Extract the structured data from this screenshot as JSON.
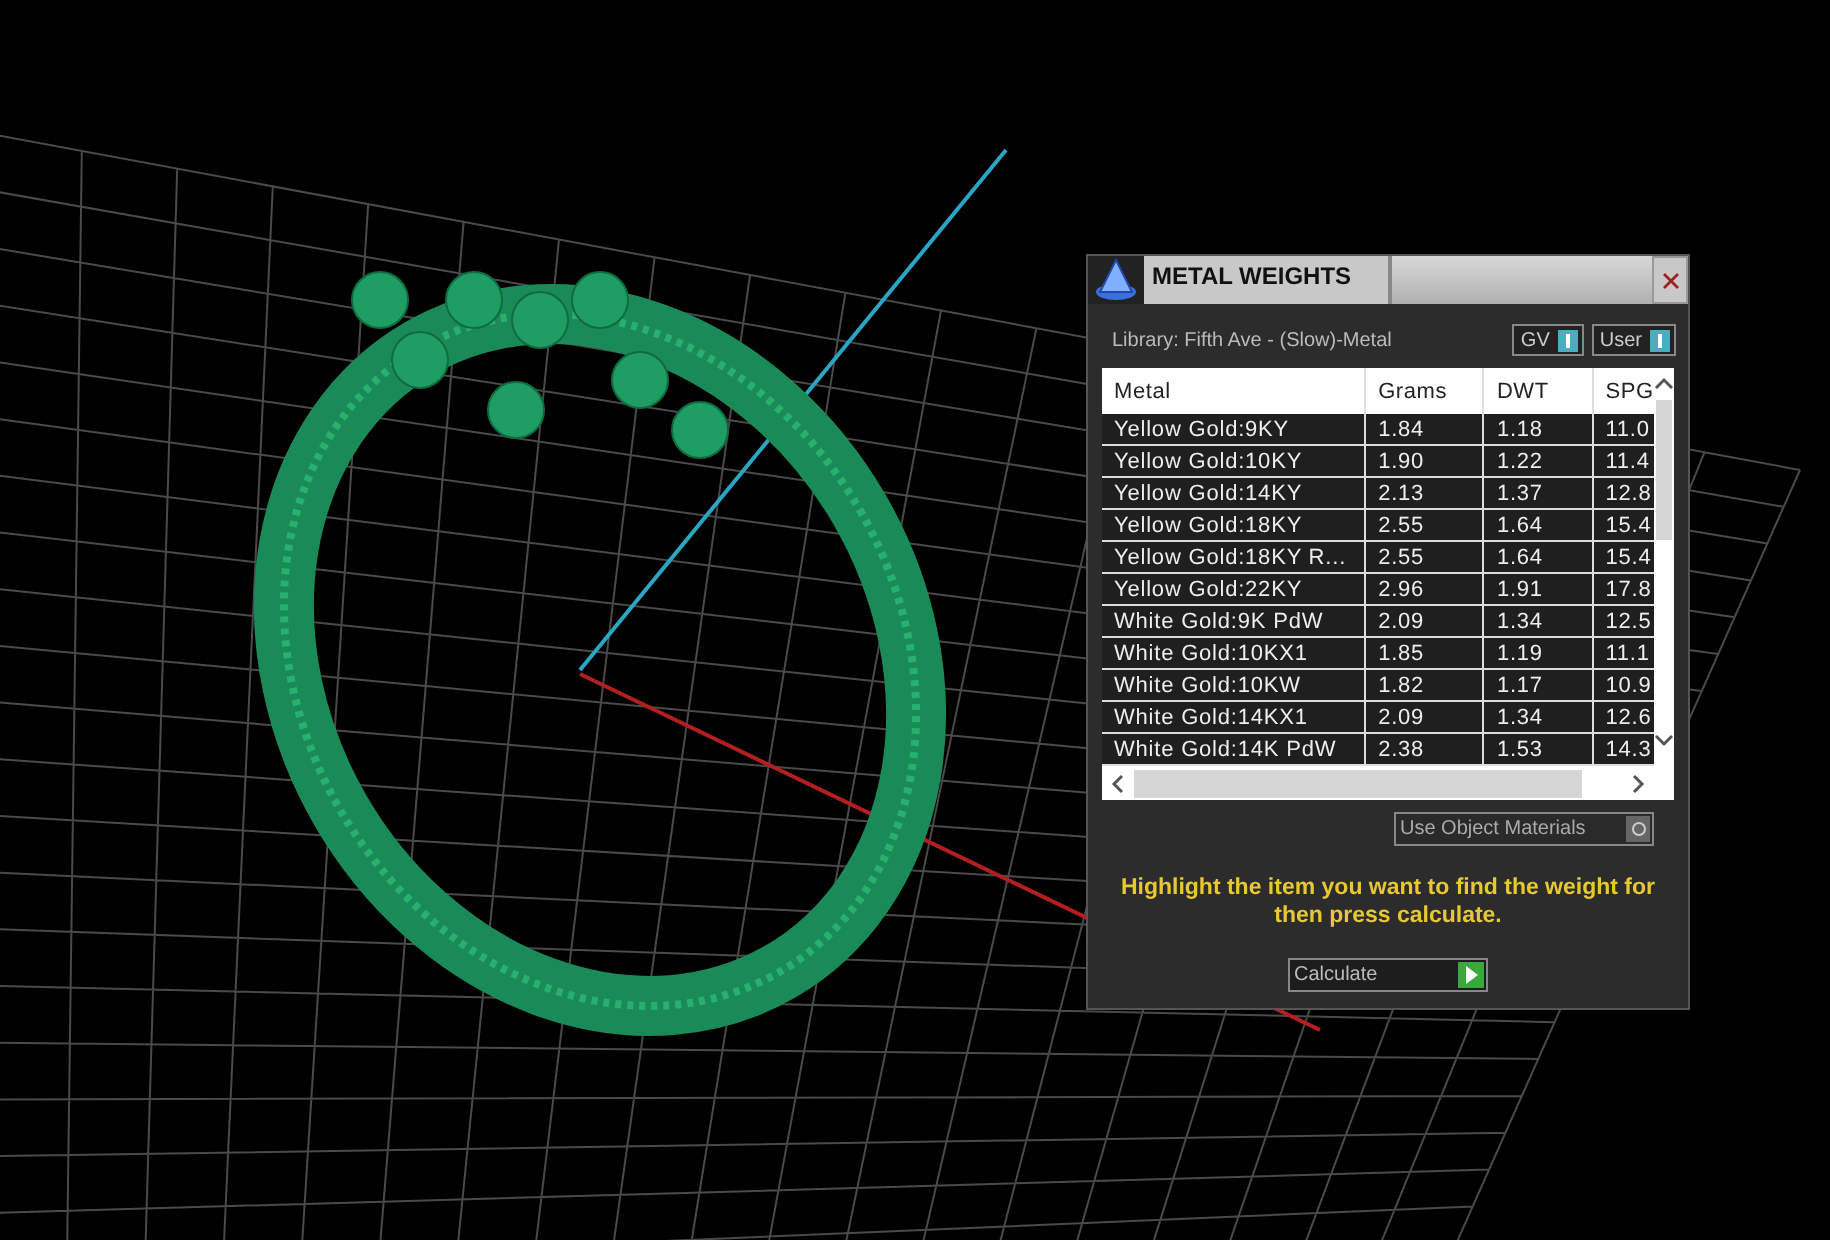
{
  "window": {
    "title": "METAL WEIGHTS"
  },
  "library": "Library: Fifth Ave - (Slow)-Metal",
  "toggles": [
    {
      "label": "GV",
      "on": true
    },
    {
      "label": "User",
      "on": true
    }
  ],
  "table": {
    "columns": [
      "Metal",
      "Grams",
      "DWT",
      "SPG"
    ],
    "rows": [
      {
        "selected": false,
        "cells": [
          "Yellow Gold:9KY",
          "1.84",
          "1.18",
          "11.0"
        ]
      },
      {
        "selected": false,
        "cells": [
          "Yellow Gold:10KY",
          "1.90",
          "1.22",
          "11.4"
        ]
      },
      {
        "selected": false,
        "cells": [
          "Yellow Gold:14KY",
          "2.13",
          "1.37",
          "12.8"
        ]
      },
      {
        "selected": false,
        "cells": [
          "Yellow Gold:18KY",
          "2.55",
          "1.64",
          "15.4"
        ]
      },
      {
        "selected": false,
        "cells": [
          "Yellow Gold:18KY R...",
          "2.55",
          "1.64",
          "15.4"
        ]
      },
      {
        "selected": false,
        "cells": [
          "Yellow Gold:22KY",
          "2.96",
          "1.91",
          "17.8"
        ]
      },
      {
        "selected": false,
        "cells": [
          "White Gold:9K PdW",
          "2.09",
          "1.34",
          "12.5"
        ]
      },
      {
        "selected": false,
        "cells": [
          "White Gold:10KX1",
          "1.85",
          "1.19",
          "11.1"
        ]
      },
      {
        "selected": false,
        "cells": [
          "White Gold:10KW",
          "1.82",
          "1.17",
          "10.9"
        ]
      },
      {
        "selected": false,
        "cells": [
          "White Gold:14KX1",
          "2.09",
          "1.34",
          "12.6"
        ]
      },
      {
        "selected": false,
        "cells": [
          "White Gold:14K PdW",
          "2.38",
          "1.53",
          "14.3"
        ]
      }
    ]
  },
  "use_object_materials": {
    "label": "Use Object Materials",
    "on": false
  },
  "message": "Highlight the item you want to find the weight for then press calculate.",
  "calculate_button": "Calculate"
}
